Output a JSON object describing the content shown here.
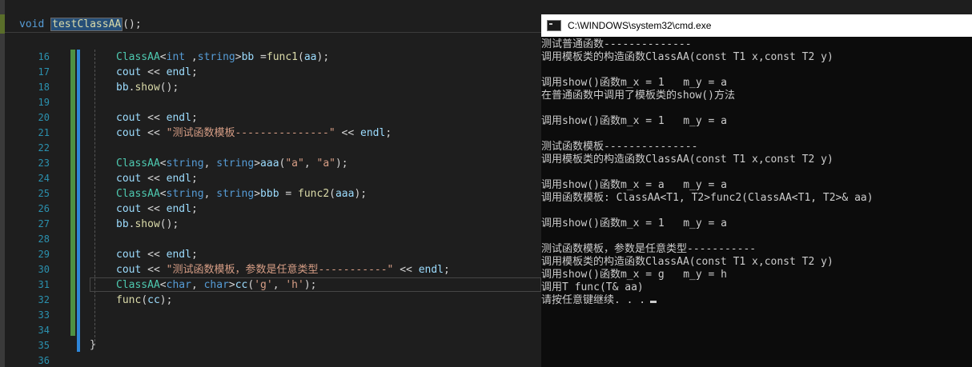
{
  "editor": {
    "signature": {
      "kw": "void",
      "fn": "testClassAA",
      "rest": "();"
    },
    "line_numbers": [
      "16",
      "17",
      "18",
      "19",
      "20",
      "21",
      "22",
      "23",
      "24",
      "25",
      "26",
      "27",
      "28",
      "29",
      "30",
      "31",
      "32",
      "33",
      "34",
      "35",
      "36"
    ],
    "lines": [
      [
        [
          "typ",
          "ClassAA"
        ],
        [
          "plain",
          "<"
        ],
        [
          "kw",
          "int"
        ],
        [
          "plain",
          " ,"
        ],
        [
          "kw",
          "string"
        ],
        [
          "plain",
          ">"
        ],
        [
          "var",
          "bb"
        ],
        [
          "plain",
          " ="
        ],
        [
          "fn",
          "func1"
        ],
        [
          "plain",
          "("
        ],
        [
          "var",
          "aa"
        ],
        [
          "plain",
          ");"
        ]
      ],
      [
        [
          "var",
          "cout"
        ],
        [
          "plain",
          " << "
        ],
        [
          "var",
          "endl"
        ],
        [
          "plain",
          ";"
        ]
      ],
      [
        [
          "var",
          "bb"
        ],
        [
          "plain",
          "."
        ],
        [
          "fn",
          "show"
        ],
        [
          "plain",
          "();"
        ]
      ],
      [],
      [
        [
          "var",
          "cout"
        ],
        [
          "plain",
          " << "
        ],
        [
          "var",
          "endl"
        ],
        [
          "plain",
          ";"
        ]
      ],
      [
        [
          "var",
          "cout"
        ],
        [
          "plain",
          " << "
        ],
        [
          "str",
          "\"测试函数模板---------------\""
        ],
        [
          "plain",
          " << "
        ],
        [
          "var",
          "endl"
        ],
        [
          "plain",
          ";"
        ]
      ],
      [],
      [
        [
          "typ",
          "ClassAA"
        ],
        [
          "plain",
          "<"
        ],
        [
          "kw",
          "string"
        ],
        [
          "plain",
          ", "
        ],
        [
          "kw",
          "string"
        ],
        [
          "plain",
          ">"
        ],
        [
          "var",
          "aaa"
        ],
        [
          "plain",
          "("
        ],
        [
          "str",
          "\"a\""
        ],
        [
          "plain",
          ", "
        ],
        [
          "str",
          "\"a\""
        ],
        [
          "plain",
          ");"
        ]
      ],
      [
        [
          "var",
          "cout"
        ],
        [
          "plain",
          " << "
        ],
        [
          "var",
          "endl"
        ],
        [
          "plain",
          ";"
        ]
      ],
      [
        [
          "typ",
          "ClassAA"
        ],
        [
          "plain",
          "<"
        ],
        [
          "kw",
          "string"
        ],
        [
          "plain",
          ", "
        ],
        [
          "kw",
          "string"
        ],
        [
          "plain",
          ">"
        ],
        [
          "var",
          "bbb"
        ],
        [
          "plain",
          " = "
        ],
        [
          "fn",
          "func2"
        ],
        [
          "plain",
          "("
        ],
        [
          "var",
          "aaa"
        ],
        [
          "plain",
          ");"
        ]
      ],
      [
        [
          "var",
          "cout"
        ],
        [
          "plain",
          " << "
        ],
        [
          "var",
          "endl"
        ],
        [
          "plain",
          ";"
        ]
      ],
      [
        [
          "var",
          "bb"
        ],
        [
          "plain",
          "."
        ],
        [
          "fn",
          "show"
        ],
        [
          "plain",
          "();"
        ]
      ],
      [],
      [
        [
          "var",
          "cout"
        ],
        [
          "plain",
          " << "
        ],
        [
          "var",
          "endl"
        ],
        [
          "plain",
          ";"
        ]
      ],
      [
        [
          "var",
          "cout"
        ],
        [
          "plain",
          " << "
        ],
        [
          "str",
          "\"测试函数模板，参数是任意类型-----------\""
        ],
        [
          "plain",
          " << "
        ],
        [
          "var",
          "endl"
        ],
        [
          "plain",
          ";"
        ]
      ],
      [
        [
          "typ",
          "ClassAA"
        ],
        [
          "plain",
          "<"
        ],
        [
          "kw",
          "char"
        ],
        [
          "plain",
          ", "
        ],
        [
          "kw",
          "char"
        ],
        [
          "plain",
          ">"
        ],
        [
          "var",
          "cc"
        ],
        [
          "plain",
          "("
        ],
        [
          "str",
          "'g'"
        ],
        [
          "plain",
          ", "
        ],
        [
          "str",
          "'h'"
        ],
        [
          "plain",
          ");"
        ]
      ],
      [
        [
          "fn",
          "func"
        ],
        [
          "plain",
          "("
        ],
        [
          "var",
          "cc"
        ],
        [
          "plain",
          ");"
        ]
      ],
      [],
      [],
      [],
      []
    ],
    "closing_brace": "}"
  },
  "cmd": {
    "title": "C:\\WINDOWS\\system32\\cmd.exe",
    "lines": [
      "测试普通函数--------------",
      "调用模板类的构造函数ClassAA(const T1 x,const T2 y)",
      "",
      "调用show()函数m_x = 1   m_y = a",
      "在普通函数中调用了模板类的show()方法",
      "",
      "调用show()函数m_x = 1   m_y = a",
      "",
      "测试函数模板---------------",
      "调用模板类的构造函数ClassAA(const T1 x,const T2 y)",
      "",
      "调用show()函数m_x = a   m_y = a",
      "调用函数模板: ClassAA<T1, T2>func2(ClassAA<T1, T2>& aa)",
      "",
      "调用show()函数m_x = 1   m_y = a",
      "",
      "测试函数模板，参数是任意类型-----------",
      "调用模板类的构造函数ClassAA(const T1 x,const T2 y)",
      "调用show()函数m_x = g   m_y = h",
      "调用T func(T& aa)",
      "请按任意键继续. . ."
    ]
  }
}
